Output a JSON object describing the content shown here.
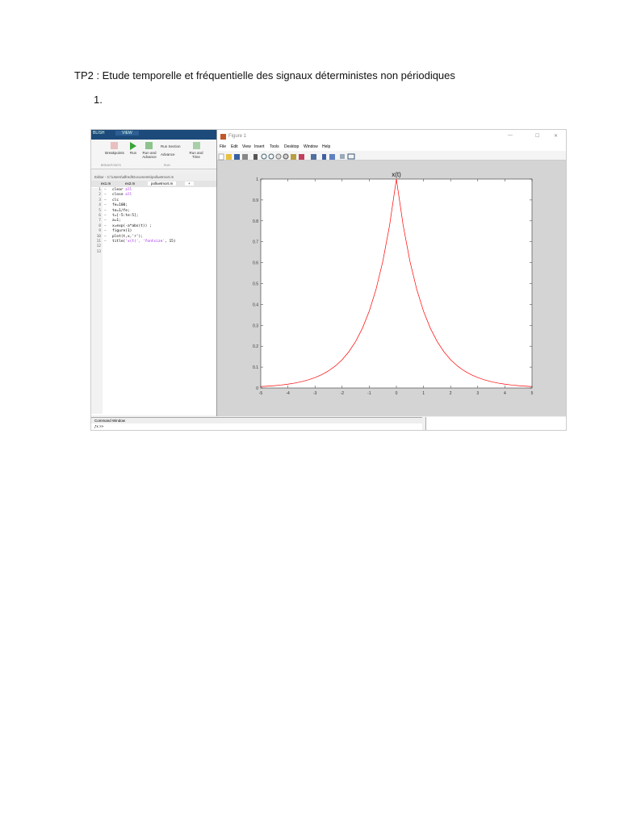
{
  "document": {
    "title": "TP2 : Etude temporelle et fréquentielle des signaux déterministes non périodiques",
    "item_number": "1."
  },
  "matlab": {
    "ribbon_tabs": [
      "BLISH",
      "VIEW"
    ],
    "ribbon_buttons": [
      "Breakpoints",
      "Run",
      "Run and Advance",
      "Run Section",
      "Advance",
      "Run and Time"
    ],
    "ribbon_groups": [
      "BREAKPOINTS",
      "RUN"
    ],
    "editor_title": "Editor - C:\\Users\\alfred\\Documents\\polluetmort.m",
    "editor_tabs": [
      "ex1.m",
      "ex2.m",
      "polluetmort.m",
      "+"
    ],
    "code_lines": [
      {
        "n": "1",
        "dash": "−",
        "code": "clear ",
        "str": "all"
      },
      {
        "n": "2",
        "dash": "−",
        "code": "close ",
        "str": "all"
      },
      {
        "n": "3",
        "dash": "−",
        "code": "clc",
        "str": ""
      },
      {
        "n": "4",
        "dash": "−",
        "code": "fe=100;",
        "str": ""
      },
      {
        "n": "5",
        "dash": "−",
        "code": "te=1/fe;",
        "str": ""
      },
      {
        "n": "6",
        "dash": "−",
        "code": "t=[-5:te:5];",
        "str": ""
      },
      {
        "n": "7",
        "dash": "−",
        "code": "a=1;",
        "str": ""
      },
      {
        "n": "8",
        "dash": "−",
        "code": "x=exp(-a*abs(t)) ;",
        "str": ""
      },
      {
        "n": "9",
        "dash": "−",
        "code": "figure(1)",
        "str": ""
      },
      {
        "n": "10",
        "dash": "−",
        "code": "plot(t,x,'r');",
        "str": ""
      },
      {
        "n": "11",
        "dash": "−",
        "code": "title(",
        "str": "'x(t)', 'fontsize'",
        "tail": ", 15)"
      },
      {
        "n": "12",
        "dash": "",
        "code": "",
        "str": ""
      },
      {
        "n": "13",
        "dash": "",
        "code": "",
        "str": ""
      }
    ],
    "command_window_label": "Command Window",
    "prompt": ">>"
  },
  "figure": {
    "window_title": "Figure 1",
    "window_controls": [
      "—",
      "☐",
      "✕"
    ],
    "menu": [
      "File",
      "Edit",
      "View",
      "Insert",
      "Tools",
      "Desktop",
      "Window",
      "Help"
    ]
  },
  "chart_data": {
    "type": "line",
    "title": "x(t)",
    "xlabel": "",
    "ylabel": "",
    "xlim": [
      -5,
      5
    ],
    "ylim": [
      0,
      1
    ],
    "xticks": [
      "-5",
      "-4",
      "-3",
      "-2",
      "-1",
      "0",
      "1",
      "2",
      "3",
      "4",
      "5"
    ],
    "yticks": [
      "0",
      "0.1",
      "0.2",
      "0.3",
      "0.4",
      "0.5",
      "0.6",
      "0.7",
      "0.8",
      "0.9",
      "1"
    ],
    "series": [
      {
        "name": "x(t) = exp(-|t|)",
        "color": "#ff0000",
        "x": [
          -5,
          -4.75,
          -4.5,
          -4.25,
          -4,
          -3.75,
          -3.5,
          -3.25,
          -3,
          -2.75,
          -2.5,
          -2.25,
          -2,
          -1.75,
          -1.5,
          -1.25,
          -1,
          -0.75,
          -0.5,
          -0.25,
          0,
          0.25,
          0.5,
          0.75,
          1,
          1.25,
          1.5,
          1.75,
          2,
          2.25,
          2.5,
          2.75,
          3,
          3.25,
          3.5,
          3.75,
          4,
          4.25,
          4.5,
          4.75,
          5
        ],
        "y": [
          0.0067,
          0.0087,
          0.0111,
          0.0143,
          0.0183,
          0.0235,
          0.0302,
          0.0388,
          0.0498,
          0.0639,
          0.0821,
          0.1054,
          0.1353,
          0.1738,
          0.2231,
          0.2865,
          0.3679,
          0.4724,
          0.6065,
          0.7788,
          1,
          0.7788,
          0.6065,
          0.4724,
          0.3679,
          0.2865,
          0.2231,
          0.1738,
          0.1353,
          0.1054,
          0.0821,
          0.0639,
          0.0498,
          0.0388,
          0.0302,
          0.0235,
          0.0183,
          0.0143,
          0.0111,
          0.0087,
          0.0067
        ]
      }
    ]
  }
}
